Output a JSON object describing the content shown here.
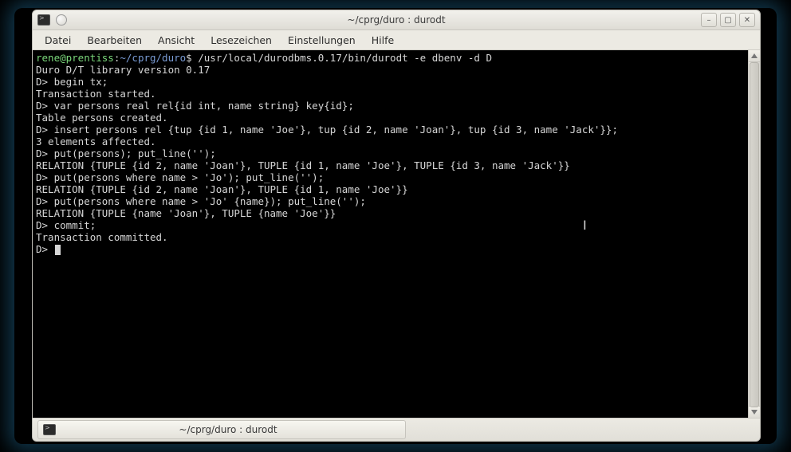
{
  "window": {
    "title": "~/cprg/duro : durodt"
  },
  "titlebar_buttons": {
    "minimize": "–",
    "maximize": "▢",
    "close": "✕"
  },
  "menu": {
    "items": [
      "Datei",
      "Bearbeiten",
      "Ansicht",
      "Lesezeichen",
      "Einstellungen",
      "Hilfe"
    ]
  },
  "terminal": {
    "prompt_user": "rene@prentiss",
    "prompt_path": "~/cprg/duro",
    "prompt_sep": "$",
    "first_command": "/usr/local/durodbms.0.17/bin/durodt -e dbenv -d D",
    "lines": [
      "Duro D/T library version 0.17",
      "D> begin tx;",
      "Transaction started.",
      "D> var persons real rel{id int, name string} key{id};",
      "Table persons created.",
      "D> insert persons rel {tup {id 1, name 'Joe'}, tup {id 2, name 'Joan'}, tup {id 3, name 'Jack'}};",
      "3 elements affected.",
      "D> put(persons); put_line('');",
      "RELATION {TUPLE {id 2, name 'Joan'}, TUPLE {id 1, name 'Joe'}, TUPLE {id 3, name 'Jack'}}",
      "D> put(persons where name > 'Jo'); put_line('');",
      "RELATION {TUPLE {id 2, name 'Joan'}, TUPLE {id 1, name 'Joe'}}",
      "D> put(persons where name > 'Jo' {name}); put_line('');",
      "RELATION {TUPLE {name 'Joan'}, TUPLE {name 'Joe'}}",
      "D> commit;",
      "Transaction committed."
    ],
    "final_prompt": "D> "
  },
  "tasktab": {
    "label": "~/cprg/duro : durodt"
  }
}
